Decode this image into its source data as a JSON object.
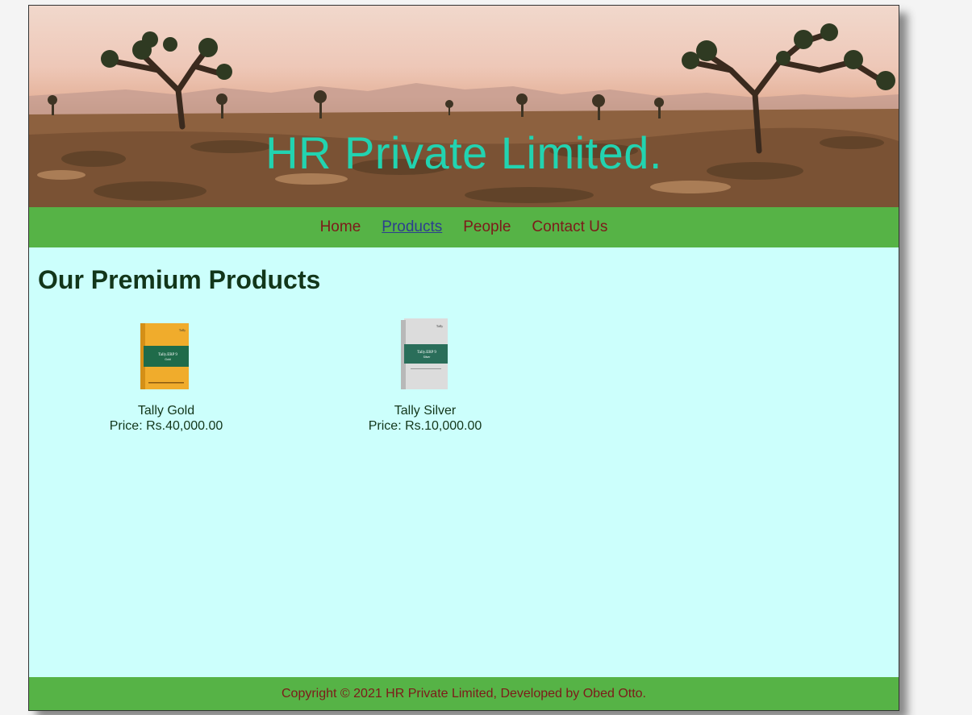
{
  "header": {
    "title": "HR Private Limited."
  },
  "nav": {
    "items": [
      {
        "label": "Home",
        "active": false
      },
      {
        "label": "Products",
        "active": true
      },
      {
        "label": "People",
        "active": false
      },
      {
        "label": "Contact Us",
        "active": false
      }
    ]
  },
  "main": {
    "heading": "Our Premium Products",
    "products": [
      {
        "name": "Tally Gold",
        "price": "Price: Rs.40,000.00",
        "box_color": "#f0ac2c",
        "band_color": "#1f6b4a",
        "box_label": "Tally.ERP 9"
      },
      {
        "name": "Tally Silver",
        "price": "Price: Rs.10,000.00",
        "box_color": "#d8d8d8",
        "band_color": "#2a6e5a",
        "box_label": "Tally.ERP 9"
      }
    ]
  },
  "footer": {
    "text": "Copyright © 2021 HR Private Limited, Developed by Obed Otto."
  },
  "colors": {
    "nav_bg": "#56b346",
    "content_bg": "#ccfffc",
    "title_color": "#22d3b0",
    "link_color": "#7d1a1a",
    "active_link_color": "#2c3e8f",
    "heading_color": "#12361a"
  }
}
